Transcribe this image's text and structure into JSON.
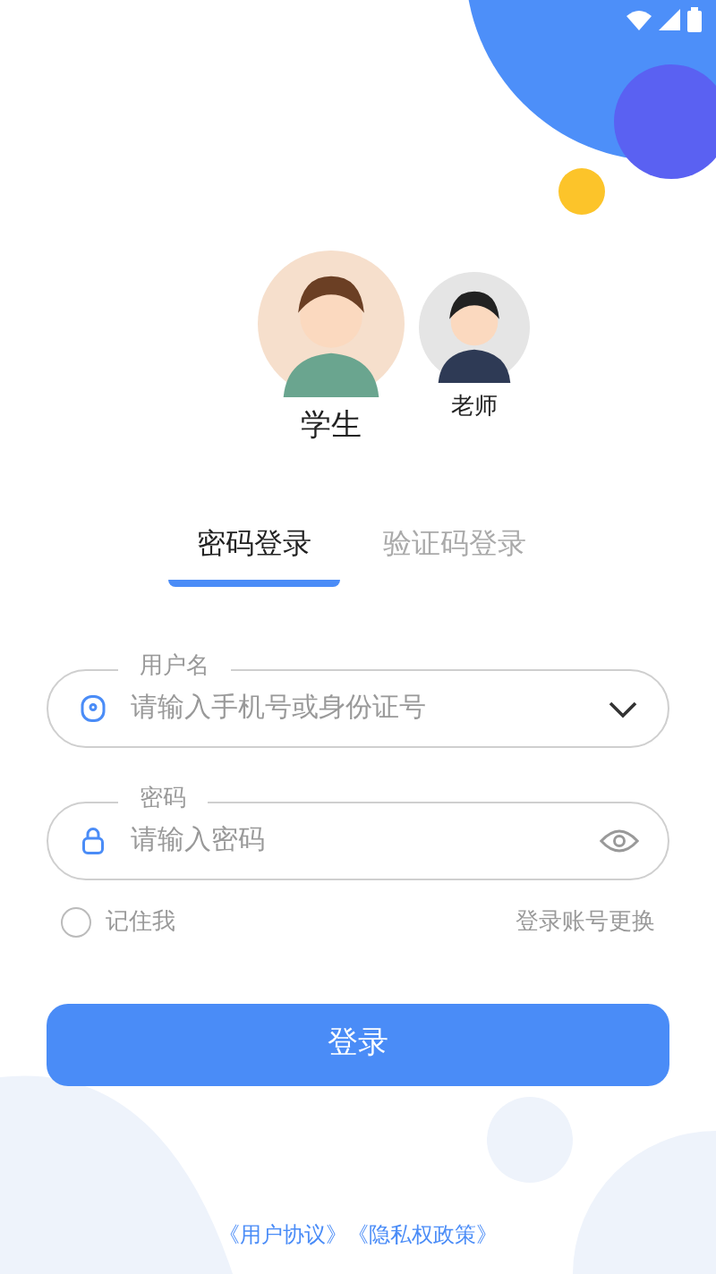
{
  "roles": [
    {
      "label": "学生",
      "selected": true
    },
    {
      "label": "老师",
      "selected": false
    }
  ],
  "tabs": [
    {
      "label": "密码登录",
      "selected": true
    },
    {
      "label": "验证码登录",
      "selected": false
    }
  ],
  "fields": [
    {
      "kind": "account",
      "legend": "用户名",
      "placeholder": "请输入手机号或身份证号"
    },
    {
      "kind": "password",
      "legend": "密码",
      "placeholder": "请输入密码"
    }
  ],
  "remember": {
    "label": "记住我",
    "checked": false
  },
  "switch_account": "登录账号更换",
  "login_button": "登录",
  "footer_links": [
    "《用户协议》",
    "《隐私权政策》"
  ]
}
